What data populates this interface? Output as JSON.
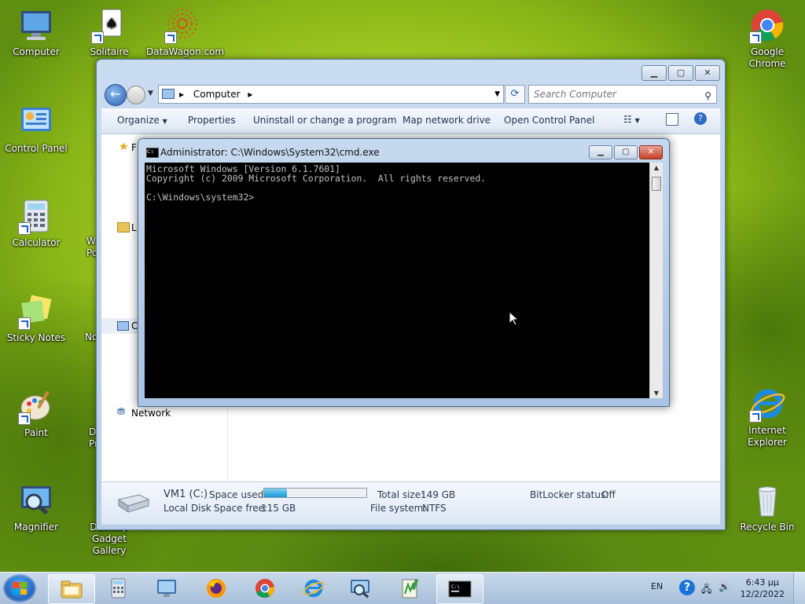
{
  "desktop": {
    "icons": {
      "computer": "Computer",
      "solitaire": "Solitaire",
      "datawagon": "DataWagon.com",
      "chrome": "Google Chrome",
      "control_panel": "Control Panel",
      "calculator": "Calculator",
      "sticky_notes": "Sticky Notes",
      "paint": "Paint",
      "internet_explorer": "Internet Explorer",
      "magnifier": "Magnifier",
      "desktop_gadget_line1": "Desktop Gadget",
      "desktop_gadget_line2": "Gallery",
      "recycle_bin": "Recycle Bin",
      "partial_wpo_1": "W",
      "partial_wpo_2": "Po",
      "partial_no": "No",
      "partial_d": "D",
      "partial_pr": "Pr"
    }
  },
  "explorer": {
    "address_crumb": "Computer",
    "search_placeholder": "Search Computer",
    "command_bar": {
      "organize": "Organize",
      "properties": "Properties",
      "uninstall": "Uninstall or change a program",
      "map_drive": "Map network drive",
      "open_control_panel": "Open Control Panel"
    },
    "nav": {
      "partial_f": "F",
      "partial_l": "L",
      "partial_c": "C",
      "network": "Network"
    },
    "details": {
      "drive_name": "VM1 (C:)",
      "drive_type": "Local Disk",
      "space_used_label": "Space used:",
      "space_used_fraction": 0.22,
      "space_free_label": "Space free:",
      "space_free_value": "115 GB",
      "total_size_label": "Total size:",
      "total_size_value": "149 GB",
      "file_system_label": "File system:",
      "file_system_value": "NTFS",
      "bitlocker_label": "BitLocker status:",
      "bitlocker_value": "Off"
    }
  },
  "cmd": {
    "title": "Administrator: C:\\Windows\\System32\\cmd.exe",
    "icon_text": "C:\\",
    "line1": "Microsoft Windows [Version 6.1.7601]",
    "line2": "Copyright (c) 2009 Microsoft Corporation.  All rights reserved.",
    "line3": "",
    "line4": "C:\\Windows\\system32>"
  },
  "taskbar": {
    "language": "EN",
    "time": "6:43 μμ",
    "date": "12/2/2022"
  }
}
